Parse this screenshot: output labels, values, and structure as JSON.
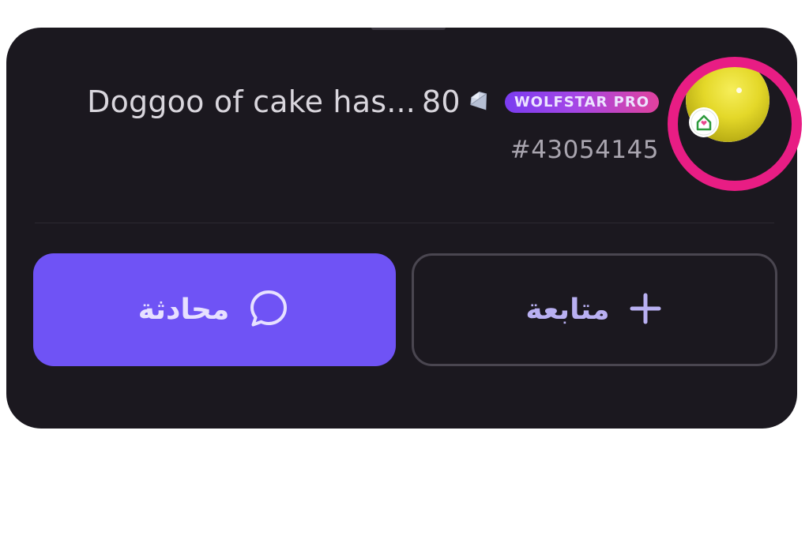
{
  "profile": {
    "name": "Doggoo of cake has...",
    "diamond_count": "80",
    "badge_label": "WOLFSTAR PRO",
    "user_id": "#43054145"
  },
  "actions": {
    "chat_label": "محادثة",
    "follow_label": "متابعة"
  },
  "icons": {
    "diamond": "gem-icon",
    "chat": "chat-bubble-icon",
    "follow": "plus-icon",
    "avatar_frame": "house-badge-icon"
  },
  "colors": {
    "card_background": "#1b181f",
    "chat_button": "#6f53f5",
    "follow_text": "#b9b0f2",
    "highlight_ring": "#e81d84",
    "badge_gradient_start": "#7a3cf0",
    "badge_gradient_end": "#e0429e"
  }
}
